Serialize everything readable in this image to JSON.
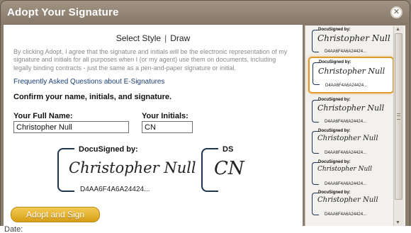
{
  "dialog": {
    "title": "Adopt Your Signature",
    "close_label": "✕"
  },
  "style_tabs": {
    "select_style": "Select Style",
    "separator": "|",
    "draw": "Draw"
  },
  "legal_text": "By clicking Adopt, I agree that the signature and initials will be the electronic representation of my signature and initials for all purposes when I (or my agent) use them on documents, including legally binding contracts - just the same as a pen-and-paper signature or initial.",
  "faq_link": "Frequently Asked Questions about E-Signatures",
  "confirm_heading": "Confirm your name, initials, and signature.",
  "form": {
    "full_name_label": "Your Full Name:",
    "full_name_value": "Christopher Null",
    "initials_label": "Your Initials:",
    "initials_value": "CN"
  },
  "preview": {
    "signature_header": "DocuSigned by:",
    "signature_text": "Christopher Null",
    "signature_id": "D4AA6F4A6A24424...",
    "initials_header": "DS",
    "initials_text": "CN"
  },
  "adopt_button": "Adopt and Sign",
  "style_options": [
    {
      "header": "DocuSigned by:",
      "signature": "Christopher Null",
      "id": "D4AA6F4A6A24424..."
    },
    {
      "header": "DocuSigned by:",
      "signature": "Christopher Null",
      "id": "D4AA6F4A6A24424..."
    },
    {
      "header": "DocuSigned by:",
      "signature": "Christopher Null",
      "id": "D4AA6F4A6A24424..."
    },
    {
      "header": "DocuSigned by:",
      "signature": "Christopher Null",
      "id": "D4AA6F4A6A24424..."
    },
    {
      "header": "DocuSigned by:",
      "signature": "Christopher Null",
      "id": "D4AA6F4A6A24424..."
    },
    {
      "header": "DocuSigned by:",
      "signature": "Christopher Null",
      "id": "D4AA6F4A6A24424..."
    }
  ],
  "selected_option_index": 1,
  "background_text": "Date:",
  "colors": {
    "accent": "#e09a2a",
    "button": "#d79f18",
    "title_bar": "#8b7d6b",
    "signature_bracket": "#1c3555"
  }
}
